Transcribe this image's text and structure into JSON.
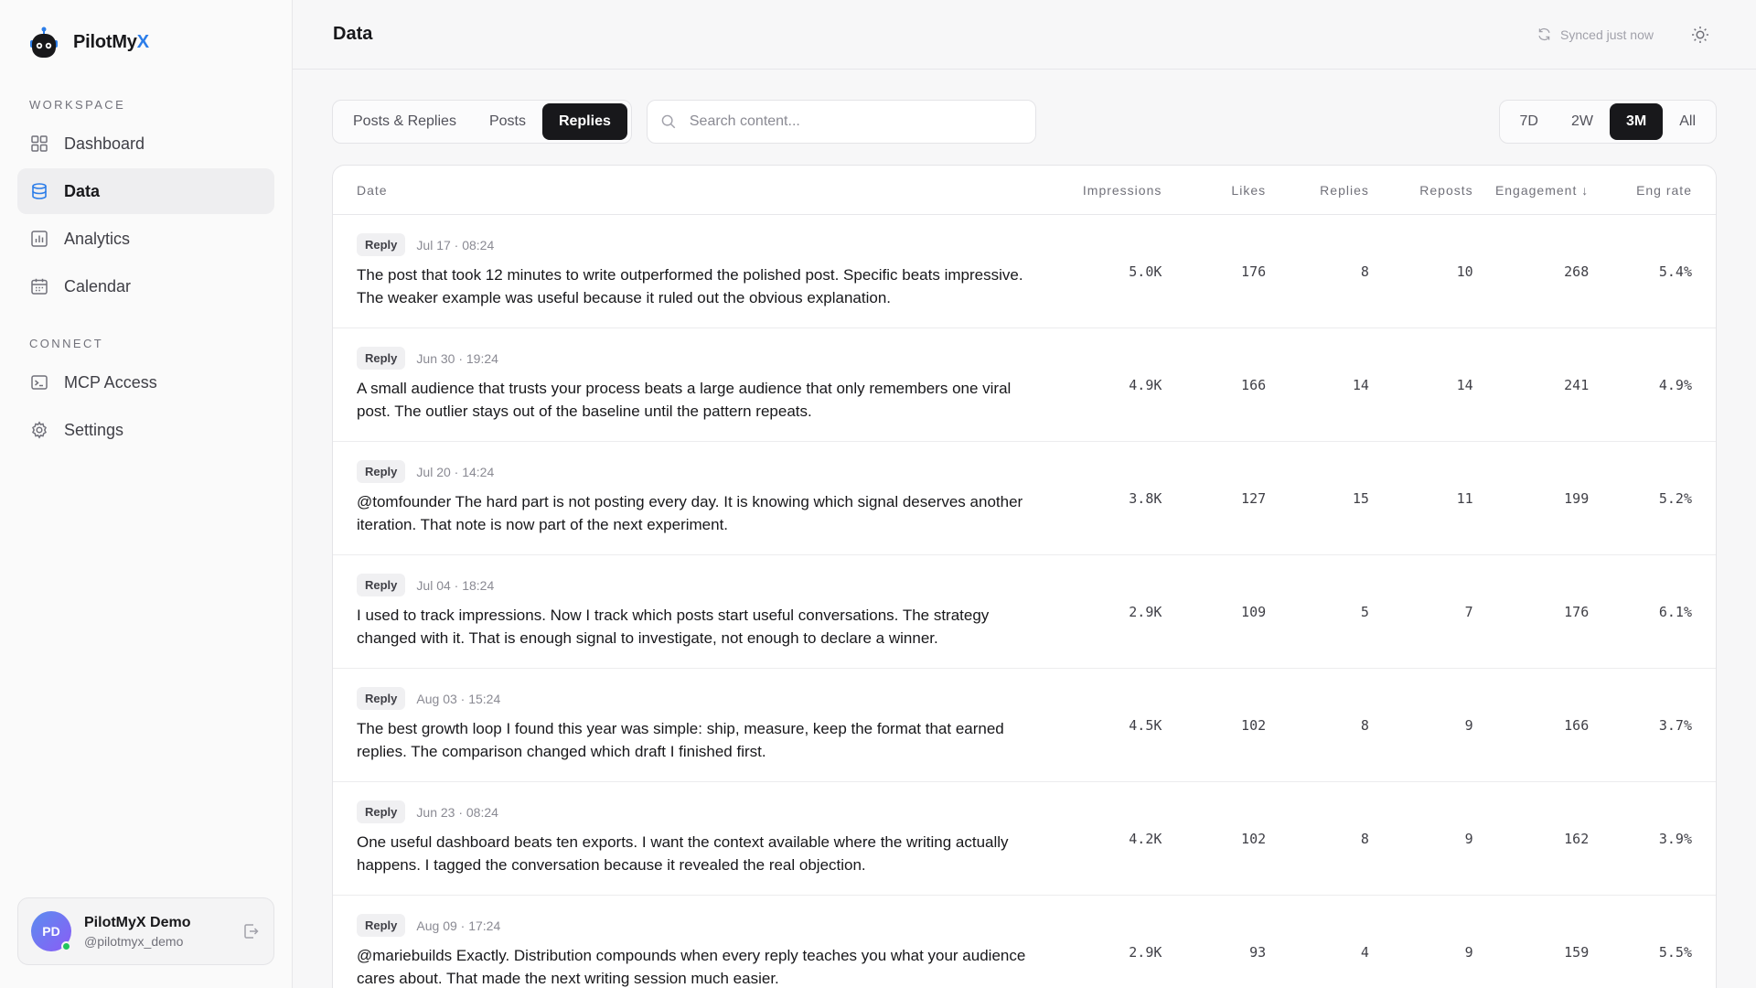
{
  "brand": {
    "name_main": "PilotMy",
    "name_accent": "X"
  },
  "sidebar": {
    "workspace_label": "WORKSPACE",
    "connect_label": "CONNECT",
    "workspace_items": [
      {
        "label": "Dashboard",
        "icon": "grid-icon"
      },
      {
        "label": "Data",
        "icon": "database-icon",
        "active": true
      },
      {
        "label": "Analytics",
        "icon": "bar-chart-icon"
      },
      {
        "label": "Calendar",
        "icon": "calendar-icon"
      }
    ],
    "connect_items": [
      {
        "label": "MCP Access",
        "icon": "terminal-icon"
      },
      {
        "label": "Settings",
        "icon": "gear-icon"
      }
    ]
  },
  "profile": {
    "initials": "PD",
    "name": "PilotMyX Demo",
    "handle": "@pilotmyx_demo"
  },
  "header": {
    "title": "Data",
    "sync_status": "Synced just now"
  },
  "filters": {
    "type_tabs": [
      "Posts & Replies",
      "Posts",
      "Replies"
    ],
    "type_active": "Replies",
    "search_placeholder": "Search content...",
    "ranges": [
      "7D",
      "2W",
      "3M",
      "All"
    ],
    "range_active": "3M"
  },
  "table": {
    "columns": {
      "date": "Date",
      "impressions": "Impressions",
      "likes": "Likes",
      "replies": "Replies",
      "reposts": "Reposts",
      "engagement": "Engagement ↓",
      "eng_rate": "Eng rate"
    },
    "rows": [
      {
        "type": "Reply",
        "date": "Jul 17 · 08:24",
        "text": "The post that took 12 minutes to write outperformed the polished post. Specific beats impressive. The weaker example was useful because it ruled out the obvious explanation.",
        "impressions": "5.0K",
        "likes": "176",
        "replies": "8",
        "reposts": "10",
        "engagement": "268",
        "eng_rate": "5.4%"
      },
      {
        "type": "Reply",
        "date": "Jun 30 · 19:24",
        "text": "A small audience that trusts your process beats a large audience that only remembers one viral post. The outlier stays out of the baseline until the pattern repeats.",
        "impressions": "4.9K",
        "likes": "166",
        "replies": "14",
        "reposts": "14",
        "engagement": "241",
        "eng_rate": "4.9%"
      },
      {
        "type": "Reply",
        "date": "Jul 20 · 14:24",
        "text": "@tomfounder The hard part is not posting every day. It is knowing which signal deserves another iteration. That note is now part of the next experiment.",
        "impressions": "3.8K",
        "likes": "127",
        "replies": "15",
        "reposts": "11",
        "engagement": "199",
        "eng_rate": "5.2%"
      },
      {
        "type": "Reply",
        "date": "Jul 04 · 18:24",
        "text": "I used to track impressions. Now I track which posts start useful conversations. The strategy changed with it. That is enough signal to investigate, not enough to declare a winner.",
        "impressions": "2.9K",
        "likes": "109",
        "replies": "5",
        "reposts": "7",
        "engagement": "176",
        "eng_rate": "6.1%"
      },
      {
        "type": "Reply",
        "date": "Aug 03 · 15:24",
        "text": "The best growth loop I found this year was simple: ship, measure, keep the format that earned replies. The comparison changed which draft I finished first.",
        "impressions": "4.5K",
        "likes": "102",
        "replies": "8",
        "reposts": "9",
        "engagement": "166",
        "eng_rate": "3.7%"
      },
      {
        "type": "Reply",
        "date": "Jun 23 · 08:24",
        "text": "One useful dashboard beats ten exports. I want the context available where the writing actually happens. I tagged the conversation because it revealed the real objection.",
        "impressions": "4.2K",
        "likes": "102",
        "replies": "8",
        "reposts": "9",
        "engagement": "162",
        "eng_rate": "3.9%"
      },
      {
        "type": "Reply",
        "date": "Aug 09 · 17:24",
        "text": "@mariebuilds Exactly. Distribution compounds when every reply teaches you what your audience cares about. That made the next writing session much easier.",
        "impressions": "2.9K",
        "likes": "93",
        "replies": "4",
        "reposts": "9",
        "engagement": "159",
        "eng_rate": "5.5%"
      }
    ]
  }
}
